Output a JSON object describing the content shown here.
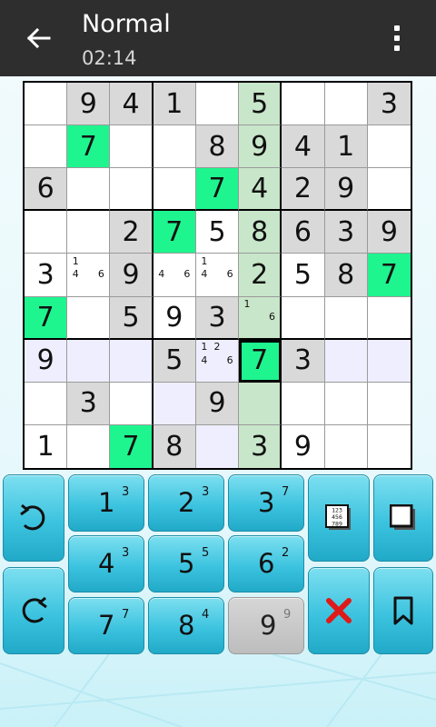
{
  "header": {
    "title": "Normal",
    "timer": "02:14"
  },
  "board": {
    "rows": [
      [
        "",
        "9",
        "4",
        "1",
        "",
        "5",
        "",
        "",
        "3"
      ],
      [
        "",
        "7",
        "",
        "",
        "8",
        "9",
        "4",
        "1",
        ""
      ],
      [
        "6",
        "",
        "",
        "",
        "7",
        "4",
        "2",
        "9",
        ""
      ],
      [
        "",
        "",
        "2",
        "7",
        "5",
        "8",
        "6",
        "3",
        "9"
      ],
      [
        "3",
        "",
        "9",
        "",
        "",
        "2",
        "5",
        "8",
        "7"
      ],
      [
        "7",
        "",
        "5",
        "9",
        "3",
        "",
        "",
        "",
        ""
      ],
      [
        "9",
        "",
        "",
        "5",
        "",
        "7",
        "3",
        "",
        ""
      ],
      [
        "",
        "3",
        "",
        "",
        "9",
        "",
        "",
        "",
        ""
      ],
      [
        "1",
        "",
        "7",
        "8",
        "",
        "3",
        "9",
        "",
        ""
      ]
    ],
    "notes": [
      {
        "row": 4,
        "col": 1,
        "values": [
          "1",
          "",
          "",
          "4",
          "",
          "6",
          "",
          "",
          ""
        ]
      },
      {
        "row": 4,
        "col": 3,
        "values": [
          "",
          "",
          "",
          "4",
          "",
          "6",
          "",
          "",
          ""
        ]
      },
      {
        "row": 4,
        "col": 4,
        "values": [
          "1",
          "",
          "",
          "4",
          "",
          "6",
          "",
          "",
          ""
        ]
      },
      {
        "row": 5,
        "col": 5,
        "values": [
          "1",
          "",
          "",
          "",
          "",
          "6",
          "",
          "",
          ""
        ]
      },
      {
        "row": 6,
        "col": 4,
        "values": [
          "1",
          "2",
          "",
          "4",
          "",
          "6",
          "",
          "",
          ""
        ]
      }
    ],
    "given": [
      "0-1",
      "0-2",
      "0-3",
      "0-5",
      "0-8",
      "1-4",
      "1-5",
      "1-6",
      "1-7",
      "2-0",
      "2-5",
      "2-6",
      "2-7",
      "3-2",
      "3-5",
      "3-6",
      "3-7",
      "3-8",
      "4-2",
      "4-5",
      "4-7",
      "5-2",
      "5-4",
      "6-3",
      "6-6",
      "7-1",
      "7-4",
      "8-3"
    ],
    "green": [
      "1-1",
      "2-4",
      "3-3",
      "4-8",
      "5-0",
      "6-5",
      "8-2"
    ],
    "selected": "6-5"
  },
  "keypad": {
    "digits": [
      {
        "digit": "1",
        "count": "3"
      },
      {
        "digit": "2",
        "count": "3"
      },
      {
        "digit": "3",
        "count": "7"
      },
      {
        "digit": "4",
        "count": "3"
      },
      {
        "digit": "5",
        "count": "5"
      },
      {
        "digit": "6",
        "count": "2"
      },
      {
        "digit": "7",
        "count": "7"
      },
      {
        "digit": "8",
        "count": "4"
      },
      {
        "digit": "9",
        "count": "9"
      }
    ],
    "notes_grid_label": "123 456 789",
    "icons": {
      "undo": "undo-icon",
      "redo": "redo-icon",
      "notes": "notes-grid-icon",
      "toggle": "square-toggle-icon",
      "erase": "erase-x-icon",
      "bookmark": "bookmark-icon"
    },
    "colors": {
      "button": "#3cc3df",
      "erase": "#e01919",
      "highlight_green": "#1ef58f"
    }
  }
}
